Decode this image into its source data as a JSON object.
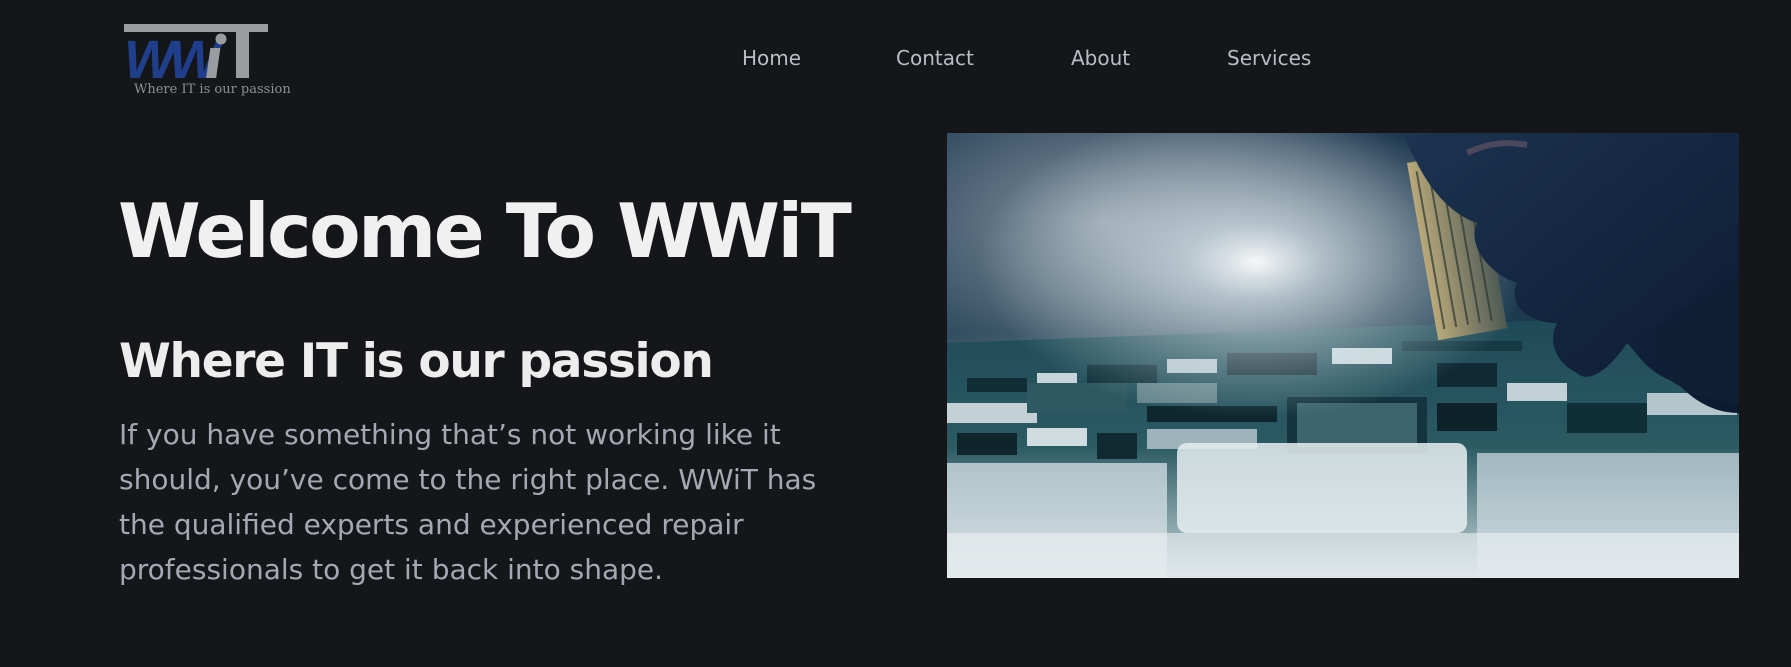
{
  "logo": {
    "text": "WWiT",
    "tagline": "Where IT is our passion",
    "colors": {
      "ww": "#1f3f8c",
      "it": "#9a9ca0",
      "bar": "#9a9ca0"
    }
  },
  "nav": {
    "items": [
      {
        "label": "Home"
      },
      {
        "label": "Contact"
      },
      {
        "label": "About"
      },
      {
        "label": "Services"
      }
    ]
  },
  "hero": {
    "title": "Welcome To WWiT",
    "subtitle": "Where IT is our passion",
    "body": "If you have something that’s not working like it should, you’ve come to the right place. WWiT has the qualified experts and experienced repair professionals to get it back into shape."
  },
  "image": {
    "subject": "circuit-board-with-hand-inserting-chip"
  },
  "colors": {
    "background": "#151619",
    "title": "#f0f0f0",
    "body": "#a3a8b2",
    "nav": "#b9bdc6"
  }
}
